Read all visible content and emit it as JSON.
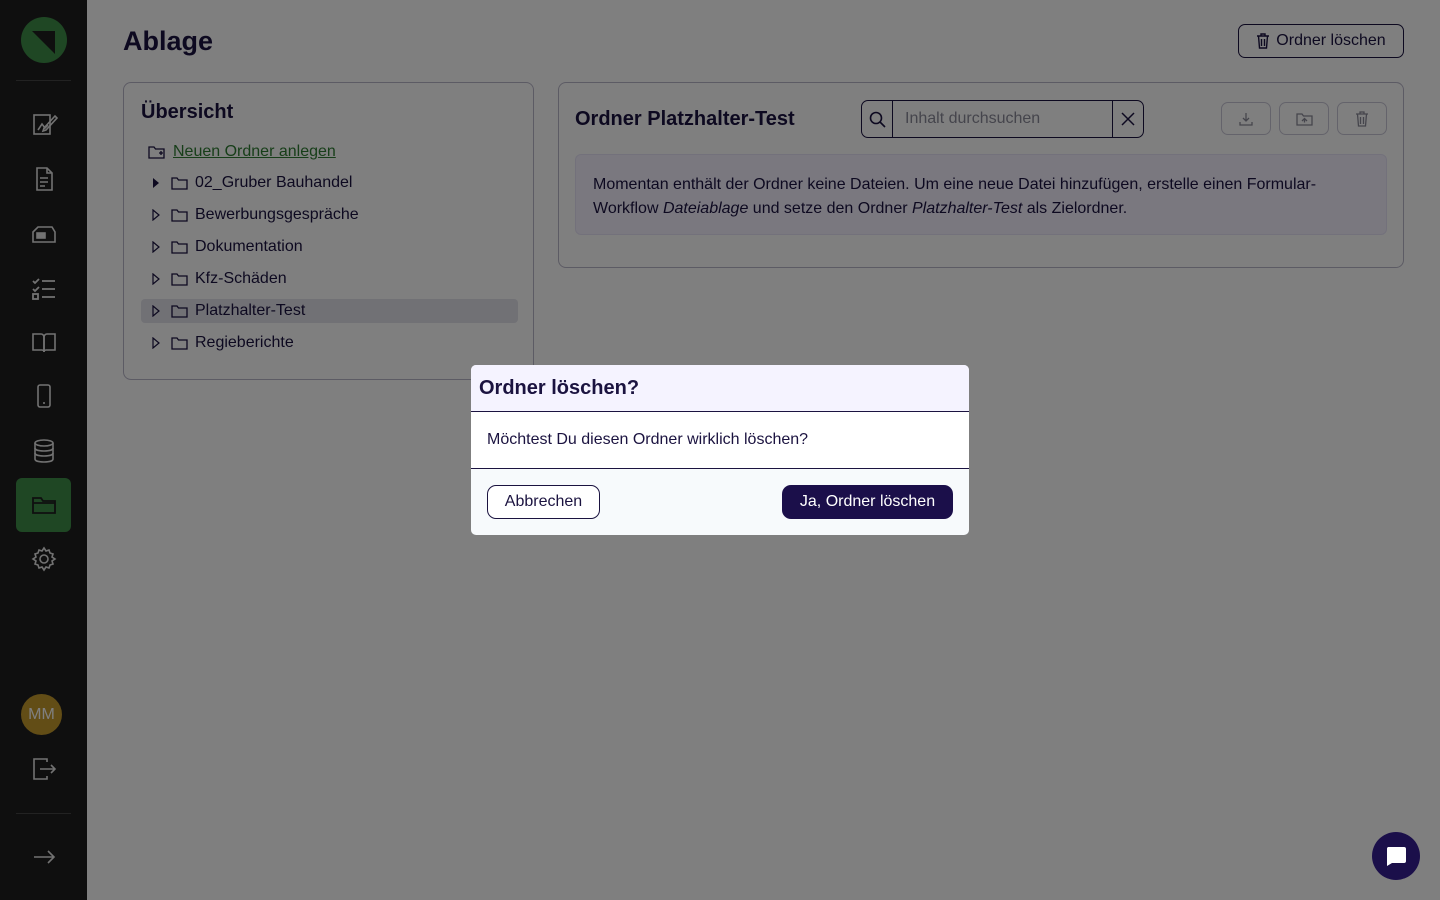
{
  "header": {
    "title": "Ablage",
    "delete_folder_label": "Ordner löschen"
  },
  "sidebar": {
    "avatar_initials": "MM",
    "items": [
      {
        "icon": "edit-form-icon"
      },
      {
        "icon": "document-icon"
      },
      {
        "icon": "inbox-icon"
      },
      {
        "icon": "checklist-icon"
      },
      {
        "icon": "book-icon"
      },
      {
        "icon": "mobile-icon"
      },
      {
        "icon": "database-icon"
      },
      {
        "icon": "folder-icon",
        "active": true
      },
      {
        "icon": "gear-icon"
      }
    ]
  },
  "overview": {
    "title": "Übersicht",
    "new_folder_label": "Neuen Ordner anlegen",
    "folders": [
      {
        "name": "02_Gruber Bauhandel",
        "expanded_indicator": "filled"
      },
      {
        "name": "Bewerbungsgespräche"
      },
      {
        "name": "Dokumentation"
      },
      {
        "name": "Kfz-Schäden"
      },
      {
        "name": "Platzhalter-Test",
        "selected": true
      },
      {
        "name": "Regieberichte"
      }
    ]
  },
  "folder": {
    "title": "Ordner Platzhalter-Test",
    "search_placeholder": "Inhalt durchsuchen",
    "info_part1": "Momentan enthält der Ordner keine Dateien. Um eine neue Datei hinzufügen, erstelle einen Formular-Workflow ",
    "info_em1": "Dateiablage",
    "info_part2": " und setze den Ordner ",
    "info_em2": "Platzhalter-Test",
    "info_part3": " als Zielordner."
  },
  "modal": {
    "title": "Ordner löschen?",
    "message": "Möchtest Du diesen Ordner wirklich löschen?",
    "cancel_label": "Abbrechen",
    "confirm_label": "Ja, Ordner löschen"
  },
  "colors": {
    "primary": "#1b0f4a",
    "active_nav": "#3e8e48",
    "sidebar_bg": "#1f1f1f",
    "link_green": "#2e7d32",
    "avatar": "#c49a2c"
  }
}
